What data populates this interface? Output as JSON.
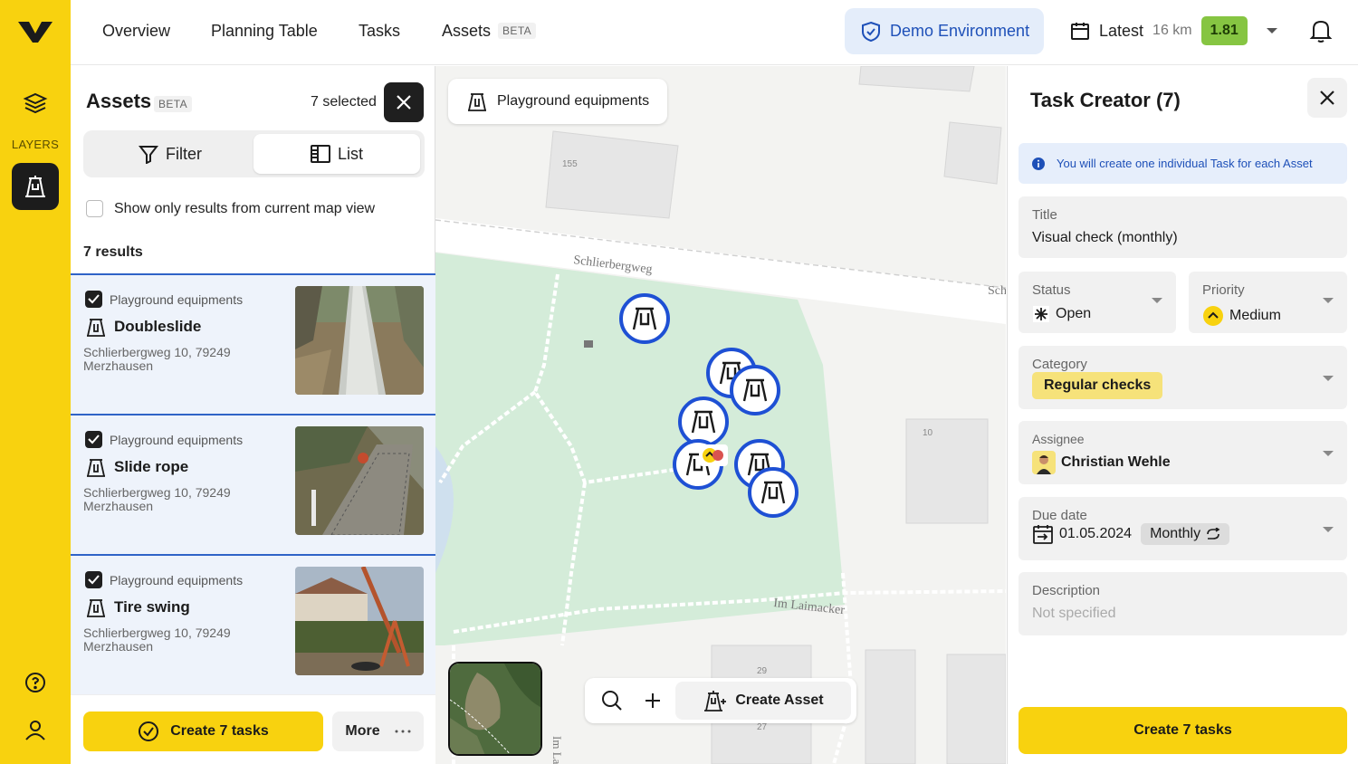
{
  "nav": {
    "overview": "Overview",
    "planning": "Planning Table",
    "tasks": "Tasks",
    "assets": "Assets",
    "assets_badge": "BETA",
    "demo": "Demo Environment",
    "latest_label": "Latest",
    "latest_km": "16 km",
    "version": "1.81"
  },
  "rail": {
    "layers_label": "LAYERS"
  },
  "assets_panel": {
    "title": "Assets",
    "badge": "BETA",
    "selected": "7 selected",
    "filter_label": "Filter",
    "list_label": "List",
    "map_view_checkbox": "Show only results from current map view",
    "results": "7 results",
    "items": [
      {
        "category": "Playground equipments",
        "name": "Doubleslide",
        "address": "Schlierbergweg 10, 79249 Merzhausen"
      },
      {
        "category": "Playground equipments",
        "name": "Slide rope",
        "address": "Schlierbergweg 10, 79249 Merzhausen"
      },
      {
        "category": "Playground equipments",
        "name": "Tire swing",
        "address": "Schlierbergweg 10, 79249 Merzhausen"
      }
    ],
    "create_btn": "Create 7 tasks",
    "more_btn": "More"
  },
  "map": {
    "layer_chip": "Playground equipments",
    "street_1": "Schlierbergweg",
    "street_1_cut": "Sch",
    "street_2": "Im Laimacker",
    "street_3": "Im La",
    "house_155": "155",
    "house_10": "10",
    "house_29": "29",
    "house_27": "27",
    "create_asset": "Create Asset"
  },
  "task_creator": {
    "title": "Task Creator (7)",
    "info": "You will create one individual Task for each Asset",
    "title_label": "Title",
    "title_value": "Visual check (monthly)",
    "status_label": "Status",
    "status_value": "Open",
    "priority_label": "Priority",
    "priority_value": "Medium",
    "category_label": "Category",
    "category_value": "Regular checks",
    "assignee_label": "Assignee",
    "assignee_value": "Christian Wehle",
    "due_label": "Due date",
    "due_value": "01.05.2024",
    "recurrence": "Monthly",
    "description_label": "Description",
    "description_value": "Not specified",
    "create_btn": "Create 7 tasks"
  },
  "colors": {
    "brand_yellow": "#f8d20f",
    "accent_blue": "#1e50b8",
    "park_green": "#d4ecd9",
    "version_green": "#86c542"
  }
}
